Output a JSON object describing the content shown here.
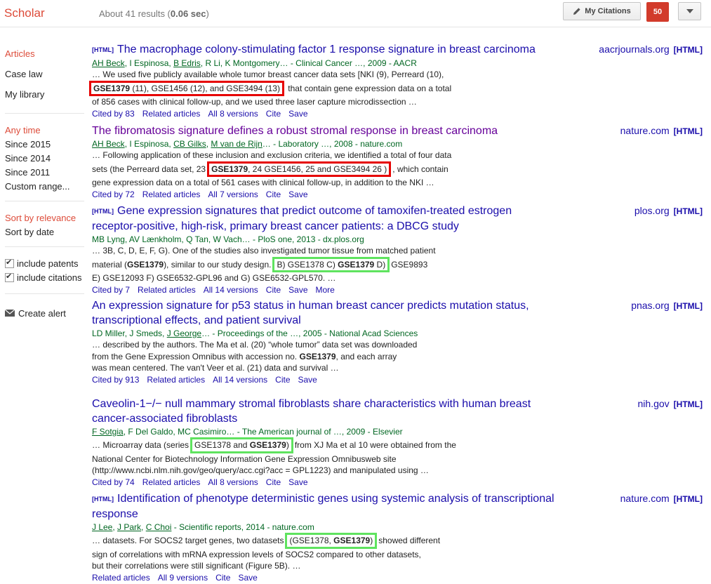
{
  "header": {
    "logo": "Scholar",
    "results_prefix": "About 41 results (",
    "results_time": "0.06 sec",
    "results_suffix": ")",
    "my_citations": "My Citations",
    "alerts_count": "50"
  },
  "sidebar": {
    "types": [
      "Articles",
      "Case law",
      "My library"
    ],
    "time": [
      "Any time",
      "Since 2015",
      "Since 2014",
      "Since 2011",
      "Custom range..."
    ],
    "sort": [
      "Sort by relevance",
      "Sort by date"
    ],
    "include_patents": "include patents",
    "include_citations": "include citations",
    "create_alert": "Create alert"
  },
  "results": [
    {
      "tag": "[HTML]",
      "title": "The macrophage colony-stimulating factor 1 response signature in breast carcinoma",
      "source": "aacrjournals.org",
      "source_tag": "[HTML]",
      "authors": [
        "AH Beck",
        "I Espinosa",
        "B Edris",
        "R Li",
        "K Montgomery"
      ],
      "meta_tail": "… - Clinical Cancer …, 2009 - AACR",
      "snip1": "… We used five publicly available whole tumor breast cancer data sets [NKI (9), Perreard (10),",
      "snip2_hl_bold": "GSE1379",
      "snip2_hl_rest": " (11), GSE1456 (12), and GSE3494 (13)",
      "snip2_tail": " that contain gene expression data on a total",
      "snip3": "of 856 cases with clinical follow-up, and we used three laser capture microdissection …",
      "links": [
        "Cited by 83",
        "Related articles",
        "All 8 versions",
        "Cite",
        "Save"
      ]
    },
    {
      "title": "The fibromatosis signature defines a robust stromal response in breast carcinoma",
      "source": "nature.com",
      "source_tag": "[HTML]",
      "authors": [
        "AH Beck",
        "I Espinosa",
        "CB Gilks",
        "M van de Rijn"
      ],
      "meta_tail": "… - Laboratory …, 2008 - nature.com",
      "snip1": "… Following application of these inclusion and exclusion criteria, we identified a total of four data",
      "snip2_head": "sets (the Perreard data set, 23",
      "snip2_hl_bold": "GSE1379",
      "snip2_hl_rest": ", 24 GSE1456, 25 and GSE3494 26 )",
      "snip2_tail": ", which contain",
      "snip3": "gene expression data on a total of 561 cases with clinical follow-up, in addition to the NKI …",
      "links": [
        "Cited by 72",
        "Related articles",
        "All 7 versions",
        "Cite",
        "Save"
      ]
    },
    {
      "tag": "[HTML]",
      "title_line1": "Gene expression signatures that predict outcome of tamoxifen-treated estrogen",
      "title_line2": "receptor-positive, high-risk, primary breast cancer patients: a DBCG study",
      "source": "plos.org",
      "source_tag": "[HTML]",
      "meta": "MB Lyng, AV Lænkholm, Q Tan, W Vach… - PloS one, 2013 - dx.plos.org",
      "snip1": "… 3B, C, D, E, F, G). One of the studies also investigated tumor tissue from matched patient",
      "snip2_head": "material (",
      "snip2_bold": "GSE1379",
      "snip2_mid": "), similar to our study design.",
      "snip2_hl_a": "B) GSE1378 C) ",
      "snip2_hl_bold": "GSE1379",
      "snip2_hl_b": " D)",
      "snip2_tail": "GSE9893",
      "snip3": "E) GSE12093 F) GSE6532-GPL96 and G) GSE6532-GPL570. …",
      "links": [
        "Cited by 7",
        "Related articles",
        "All 14 versions",
        "Cite",
        "Save",
        "More"
      ]
    },
    {
      "title_line1": "An expression signature for p53 status in human breast cancer predicts mutation status,",
      "title_line2": "transcriptional effects, and patient survival",
      "source": "pnas.org",
      "source_tag": "[HTML]",
      "authors": [
        "LD Miller",
        "J Smeds",
        "J George"
      ],
      "meta_tail": "… - Proceedings of the …, 2005 - National Acad Sciences",
      "snip1": "… described by the authors. The Ma et al. (20) “whole tumor” data set was downloaded",
      "snip2_head": "from the Gene Expression Omnibus with accession no. ",
      "snip2_bold": "GSE1379",
      "snip2_tail": ", and each array",
      "snip3": "was mean centered. The van't Veer et al. (21) data and survival …",
      "links": [
        "Cited by 913",
        "Related articles",
        "All 14 versions",
        "Cite",
        "Save"
      ]
    },
    {
      "title_line1": "Caveolin-1−/− null mammary stromal fibroblasts share characteristics with human breast",
      "title_line2": "cancer-associated fibroblasts",
      "source": "nih.gov",
      "source_tag": "[HTML]",
      "authors": [
        "F Sotgia",
        "F Del Galdo",
        "MC Casimiro"
      ],
      "meta_tail": "… - The American journal of …, 2009 - Elsevier",
      "snip1_head": "… Microarray data (series",
      "snip1_hl_a": "GSE1378 and ",
      "snip1_hl_bold": "GSE1379",
      "snip1_hl_b": ")",
      "snip1_tail": "from XJ Ma et al 10 were obtained from the",
      "snip2": "National Center for Biotechnology Information Gene Expression Omnibusweb site",
      "snip3": "(http://www.ncbi.nlm.nih.gov/geo/query/acc.cgi?acc = GPL1223) and manipulated using …",
      "links": [
        "Cited by 74",
        "Related articles",
        "All 8 versions",
        "Cite",
        "Save"
      ]
    },
    {
      "tag": "[HTML]",
      "title_line1": "Identification of phenotype deterministic genes using systemic analysis of transcriptional",
      "title_line2": "response",
      "source": "nature.com",
      "source_tag": "[HTML]",
      "authors": [
        "J Lee",
        "J Park",
        "C Choi"
      ],
      "meta_tail": " - Scientific reports, 2014 - nature.com",
      "snip1_head": "… datasets. For SOCS2 target genes, two datasets",
      "snip1_hl_a": "(GSE1378, ",
      "snip1_hl_bold": "GSE1379",
      "snip1_hl_b": ")",
      "snip1_tail": "showed different",
      "snip2": "sign of correlations with mRNA expression levels of SOCS2 compared to other datasets,",
      "snip3": "but their correlations were still significant (Figure 5B). …",
      "links": [
        "Related articles",
        "All 9 versions",
        "Cite",
        "Save"
      ]
    }
  ]
}
